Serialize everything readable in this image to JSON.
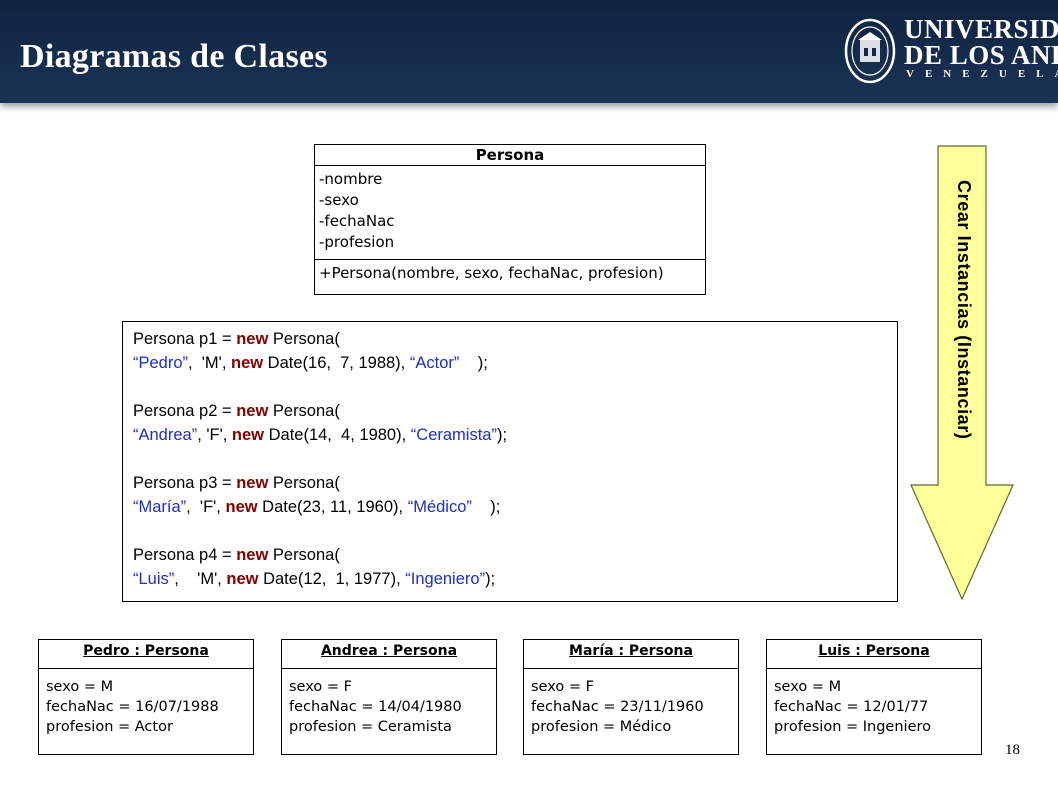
{
  "header": {
    "title": "Diagramas de Clases",
    "logo": {
      "line1": "UNIVERSIDAD",
      "line2": "DE LOS ANDES",
      "line3": "VENEZUELA"
    }
  },
  "class_box": {
    "name": "Persona",
    "attributes": [
      "-nombre",
      "-sexo",
      "-fechaNac",
      "-profesion"
    ],
    "operations": [
      "+Persona(nombre, sexo, fechaNac, profesion)"
    ]
  },
  "code": [
    {
      "decl": "Persona p1 = ",
      "kw": "new",
      "ctor": " Persona(",
      "args": [
        {
          "t": "str",
          "v": "“Pedro”"
        },
        {
          "t": "plain",
          "v": ",  'M', "
        },
        {
          "t": "kw",
          "v": "new"
        },
        {
          "t": "plain",
          "v": " Date(16,  7, 1988), "
        },
        {
          "t": "str",
          "v": "“Actor”"
        },
        {
          "t": "plain",
          "v": "    );"
        }
      ]
    },
    {
      "decl": "Persona p2 = ",
      "kw": "new",
      "ctor": " Persona(",
      "args": [
        {
          "t": "str",
          "v": "“Andrea”"
        },
        {
          "t": "plain",
          "v": ", 'F', "
        },
        {
          "t": "kw",
          "v": "new"
        },
        {
          "t": "plain",
          "v": " Date(14,  4, 1980), "
        },
        {
          "t": "str",
          "v": "“Ceramista”"
        },
        {
          "t": "plain",
          "v": ");"
        }
      ]
    },
    {
      "decl": "Persona p3 = ",
      "kw": "new",
      "ctor": " Persona(",
      "args": [
        {
          "t": "str",
          "v": "“María”"
        },
        {
          "t": "plain",
          "v": ",  'F', "
        },
        {
          "t": "kw",
          "v": "new"
        },
        {
          "t": "plain",
          "v": " Date(23, 11, 1960), "
        },
        {
          "t": "str",
          "v": "“Médico”"
        },
        {
          "t": "plain",
          "v": "    );"
        }
      ]
    },
    {
      "decl": "Persona p4 = ",
      "kw": "new",
      "ctor": " Persona(",
      "args": [
        {
          "t": "str",
          "v": "“Luis”"
        },
        {
          "t": "plain",
          "v": ",    'M', "
        },
        {
          "t": "kw",
          "v": "new"
        },
        {
          "t": "plain",
          "v": " Date(12,  1, 1977), "
        },
        {
          "t": "str",
          "v": "“Ingeniero”"
        },
        {
          "t": "plain",
          "v": ");"
        }
      ]
    }
  ],
  "arrow_label": "Crear Instancias (Instanciar)",
  "objects": [
    {
      "name": "Pedro : Persona",
      "attrs": [
        "sexo = M",
        "fechaNac = 16/07/1988",
        "profesion = Actor"
      ]
    },
    {
      "name": "Andrea : Persona",
      "attrs": [
        "sexo = F",
        "fechaNac = 14/04/1980",
        "profesion = Ceramista"
      ]
    },
    {
      "name": "María : Persona",
      "attrs": [
        "sexo = F",
        "fechaNac = 23/11/1960",
        "profesion = Médico"
      ]
    },
    {
      "name": "Luis : Persona",
      "attrs": [
        "sexo = M",
        "fechaNac = 12/01/77",
        "profesion = Ingeniero"
      ]
    }
  ],
  "page_number": "18",
  "colors": {
    "header_bg": "#14294a",
    "keyword": "#800000",
    "string": "#1e2ec8",
    "arrow_fill": "#ffff99"
  }
}
